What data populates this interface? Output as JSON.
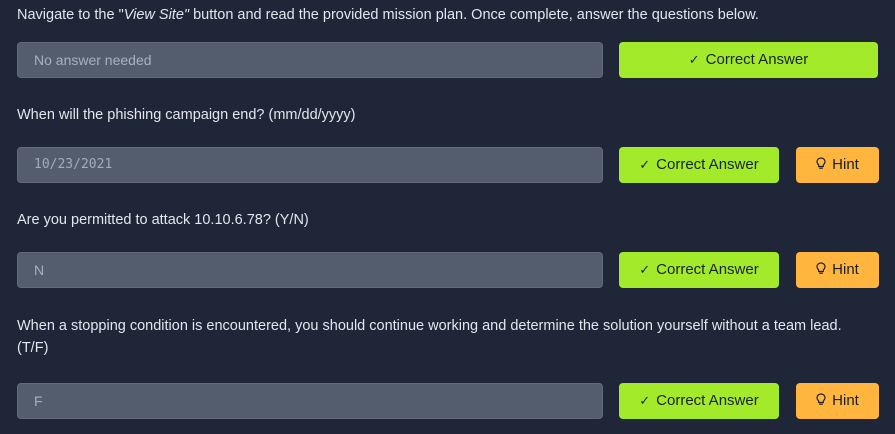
{
  "questions": [
    {
      "text_before": "Navigate to the \"",
      "text_emph": "View Site\"",
      "text_after": "  button and read the provided mission plan. Once complete, answer the questions below.",
      "answer": "No answer needed",
      "correct_label": "Correct Answer",
      "hint_label": null
    },
    {
      "text": "When will the phishing campaign end? (mm/dd/yyyy)",
      "answer": "10/23/2021",
      "correct_label": "Correct Answer",
      "hint_label": "Hint"
    },
    {
      "text": "Are you permitted to attack 10.10.6.78? (Y/N)",
      "answer": "N",
      "correct_label": "Correct Answer",
      "hint_label": "Hint"
    },
    {
      "text": "When a stopping condition is encountered, you should continue working and determine the solution yourself without a team lead. (T/F)",
      "answer": "F",
      "correct_label": "Correct Answer",
      "hint_label": "Hint"
    }
  ],
  "icons": {
    "check": "check-icon",
    "hint": "lightbulb-icon"
  },
  "colors": {
    "background": "#1f2637",
    "field": "#545d6e",
    "correct": "#a3ea2a",
    "hint": "#ffb53e"
  }
}
